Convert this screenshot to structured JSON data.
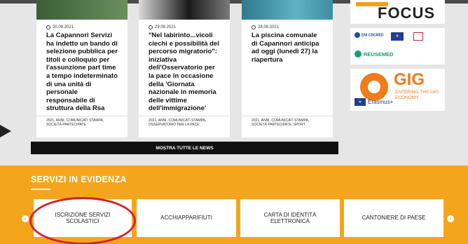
{
  "news": [
    {
      "date": "30.09.2021",
      "title": "La Capannori Servizi ha indetto un bando di selezione pubblica per titoli e colloquio per l'assunzione part time a tempo indeterminato di una unità di personale responsabile di struttura della Rsa",
      "tags": "2021, ANNI, COMUNICATI STAMPA, SOCIETÀ PARTECIPATE"
    },
    {
      "date": "29.09.2021",
      "title": "\"Nel labirinto...vicoli ciechi e possibilità del percorso migratorio\": iniziativa dell'Osservatorio per la pace in occasione della 'Giornata nazionale in memoria delle vittime dell'immigrazione'",
      "tags": "2021, ANNI, COMUNICATI STAMPA, OSSERVATORIO PER LA PACE"
    },
    {
      "date": "28.09.2021",
      "title": "La piscina comunale di Capannori anticipa ad oggi (lunedì 27) la riapertura",
      "tags": "2021, ANNI, COMUNICATI STAMPA, SOCIETÀ PARTECIPATE, SPORT"
    }
  ],
  "show_all_label": "MOSTRA TUTTE LE NEWS",
  "partners": {
    "focus": "FOCUS",
    "eni": "ENI CBCMED",
    "reusemed": "REUSEMED",
    "gig": "GIG",
    "gig_sub": "ENTERING THE GIG ECONOMY",
    "erasmus": "Erasmus+"
  },
  "services": {
    "title": "SERVIZI IN EVIDENZA",
    "items": [
      "ISCRIZIONE SERVIZI SCOLASTICI",
      "ACCHIAPPARIFIUTI",
      "CARTA DI IDENTITÀ ELETTRONICA",
      "CANTONIERE DI PAESE"
    ],
    "prev_icon": "chevron-left",
    "next_icon": "chevron-right"
  },
  "colors": {
    "accent": "#f5a51c",
    "highlight_circle": "#d4212b"
  }
}
